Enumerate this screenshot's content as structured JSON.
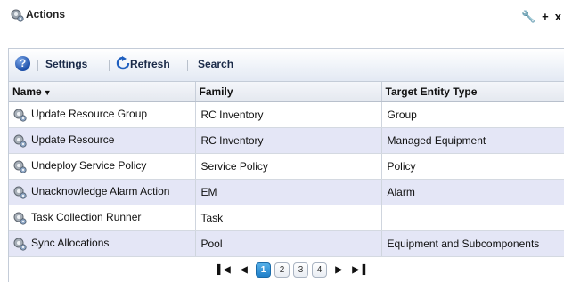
{
  "window": {
    "title": "Actions",
    "tools": [
      "wrench-icon",
      "plus-icon",
      "close-icon"
    ]
  },
  "toolbar": {
    "help_icon": "help-icon",
    "settings_label": "Settings",
    "refresh_label": "Refresh",
    "search_label": "Search"
  },
  "table": {
    "columns": [
      "Name",
      "Family",
      "Target Entity Type"
    ],
    "sort_column": "Name",
    "sort_direction": "descending",
    "rows": [
      {
        "name": "Update Resource Group",
        "family": "RC Inventory",
        "target": "Group"
      },
      {
        "name": "Update Resource",
        "family": "RC Inventory",
        "target": "Managed Equipment"
      },
      {
        "name": "Undeploy Service Policy",
        "family": "Service Policy",
        "target": "Policy"
      },
      {
        "name": "Unacknowledge Alarm Action",
        "family": "EM",
        "target": "Alarm"
      },
      {
        "name": "Task Collection Runner",
        "family": "Task",
        "target": ""
      },
      {
        "name": "Sync Allocations",
        "family": "Pool",
        "target": "Equipment and Subcomponents"
      }
    ]
  },
  "pager": {
    "pages": [
      "1",
      "2",
      "3",
      "4"
    ],
    "current_page": "1"
  },
  "colors": {
    "row_alt": "#e4e6f6",
    "active_page": "#1f7fc9"
  }
}
